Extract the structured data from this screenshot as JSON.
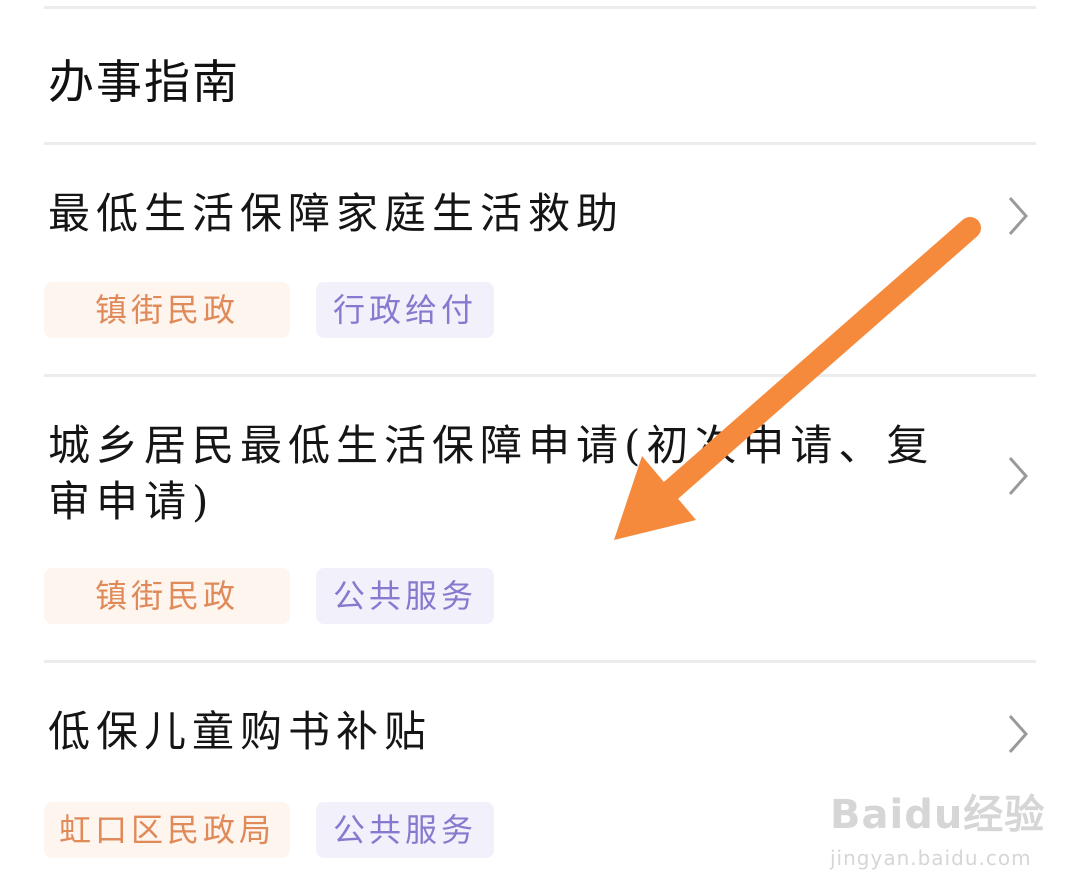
{
  "section": {
    "title": "办事指南"
  },
  "items": [
    {
      "title": "最低生活保障家庭生活救助",
      "tags": [
        "镇街民政",
        "行政给付"
      ]
    },
    {
      "title": "城乡居民最低生活保障申请(初次申请、复审申请)",
      "tags": [
        "镇街民政",
        "公共服务"
      ]
    },
    {
      "title": "低保儿童购书补贴",
      "tags": [
        "虹口区民政局",
        "公共服务"
      ]
    }
  ],
  "icons": {
    "chevron": "chevron-right-icon",
    "annotation": "arrow-annotation"
  },
  "colors": {
    "arrow": "#f58a3c",
    "tag_orange_text": "#e08a5a",
    "tag_orange_bg": "#fdf5ee",
    "tag_purple_text": "#8879cf",
    "tag_purple_bg": "#f1f0fb",
    "chevron": "#9a9a9a"
  },
  "watermark": {
    "logo": "Baidu经验",
    "url": "jingyan.baidu.com"
  }
}
